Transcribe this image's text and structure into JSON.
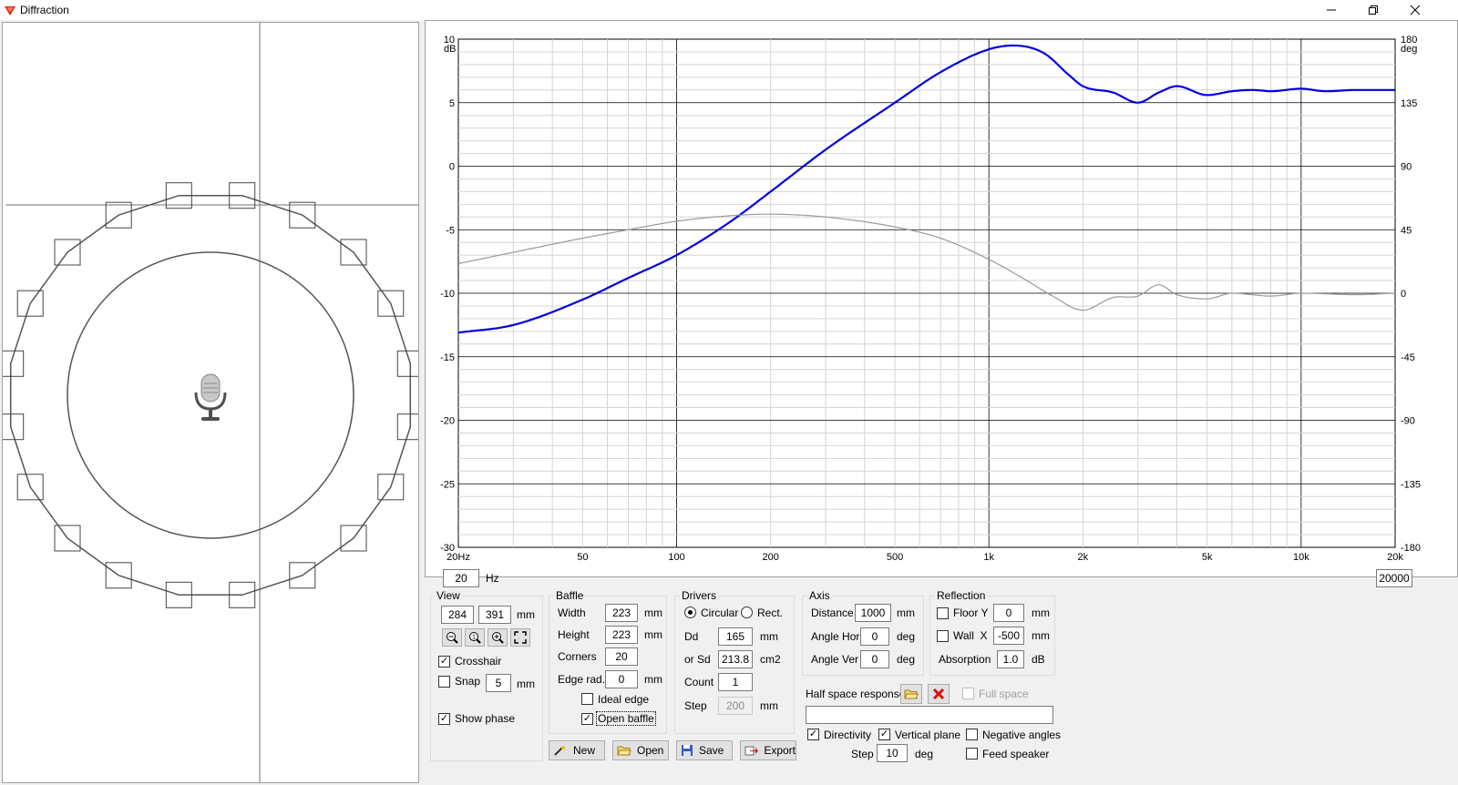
{
  "window": {
    "title": "Diffraction"
  },
  "graph": {
    "y_left_ticks": [
      "10",
      "5",
      "0",
      "-5",
      "-10",
      "-15",
      "-20",
      "-25",
      "-30"
    ],
    "y_left_unit": "dB",
    "y_right_ticks": [
      "180",
      "135",
      "90",
      "45",
      "0",
      "-45",
      "-90",
      "-135",
      "-180"
    ],
    "y_right_unit": "deg",
    "x_ticks": [
      "20Hz",
      "50",
      "100",
      "200",
      "500",
      "1k",
      "2k",
      "5k",
      "10k",
      "20k"
    ],
    "freq_min": "20",
    "freq_unit": "Hz",
    "freq_max": "20000"
  },
  "chart_data": {
    "type": "line",
    "x_scale": "log",
    "xlim": [
      20,
      20000
    ],
    "ylim": [
      -30,
      10
    ],
    "y2lim": [
      -180,
      180
    ],
    "grid": true,
    "series": [
      {
        "color": "#0000e0",
        "axis": "left",
        "x": [
          20,
          30,
          50,
          70,
          100,
          150,
          200,
          300,
          500,
          700,
          1000,
          1200,
          1500,
          1800,
          2000,
          2500,
          3000,
          3500,
          4000,
          5000,
          6000,
          7000,
          8000,
          10000,
          12000,
          15000,
          20000
        ],
        "values": [
          -13.1,
          -12.5,
          -10.5,
          -8.8,
          -7.0,
          -4.3,
          -2.0,
          1.3,
          5.0,
          7.4,
          9.2,
          9.5,
          8.9,
          7.2,
          6.3,
          5.8,
          5.0,
          5.8,
          6.3,
          5.6,
          5.9,
          6.0,
          5.9,
          6.1,
          5.9,
          6.0,
          6.0
        ]
      },
      {
        "color": "#999999",
        "axis": "right",
        "x": [
          20,
          30,
          50,
          70,
          100,
          150,
          200,
          300,
          500,
          700,
          1000,
          1300,
          1600,
          2000,
          2500,
          3000,
          3500,
          4000,
          5000,
          6000,
          8000,
          10000,
          15000,
          20000
        ],
        "values": [
          21,
          29,
          39,
          45,
          51,
          55,
          56,
          54,
          47,
          39,
          24,
          10,
          -2,
          -12,
          -3,
          -2,
          6,
          -1,
          -4,
          0,
          -2,
          0,
          -1,
          0
        ]
      }
    ]
  },
  "baffle": {
    "corner_count": 20
  },
  "view": {
    "title": "View",
    "x": "284",
    "y": "391",
    "unit": "mm",
    "crosshair_label": "Crosshair",
    "crosshair_checked": "✓",
    "snap_label": "Snap",
    "snap_value": "5",
    "snap_unit": "mm",
    "show_phase_label": "Show phase",
    "show_phase_checked": "✓"
  },
  "baffle_panel": {
    "title": "Baffle",
    "width_label": "Width",
    "width": "223",
    "width_unit": "mm",
    "height_label": "Height",
    "height": "223",
    "height_unit": "mm",
    "corners_label": "Corners",
    "corners": "20",
    "edge_label": "Edge rad.",
    "edge": "0",
    "edge_unit": "mm",
    "ideal_edge_label": "Ideal edge",
    "open_baffle_label": "Open baffle",
    "open_baffle_checked": "✓"
  },
  "drivers": {
    "title": "Drivers",
    "circular_label": "Circular",
    "rect_label": "Rect.",
    "dd_label": "Dd",
    "dd": "165",
    "dd_unit": "mm",
    "sd_label": "or Sd",
    "sd": "213.8",
    "sd_unit": "cm2",
    "count_label": "Count",
    "count": "1",
    "step_label": "Step",
    "step": "200",
    "step_unit": "mm"
  },
  "axis": {
    "title": "Axis",
    "distance_label": "Distance",
    "distance": "1000",
    "distance_unit": "mm",
    "angle_hor_label": "Angle Hor",
    "angle_hor": "0",
    "angle_hor_unit": "deg",
    "angle_ver_label": "Angle Ver",
    "angle_ver": "0",
    "angle_ver_unit": "deg"
  },
  "reflection": {
    "title": "Reflection",
    "floor_label": "Floor Y",
    "floor": "0",
    "floor_unit": "mm",
    "wall_label": "Wall  X",
    "wall": "-500",
    "wall_unit": "mm",
    "absorption_label": "Absorption",
    "absorption": "1.0",
    "absorption_unit": "dB"
  },
  "half_space": {
    "label": "Half space response",
    "full_space_label": "Full space"
  },
  "bottom": {
    "directivity_label": "Directivity",
    "directivity_checked": "✓",
    "vertical_label": "Vertical plane",
    "vertical_checked": "✓",
    "negative_label": "Negative angles",
    "feed_label": "Feed speaker",
    "step_label": "Step",
    "step": "10",
    "step_unit": "deg"
  },
  "buttons": {
    "new": "New",
    "open": "Open",
    "save": "Save",
    "export": "Export"
  }
}
